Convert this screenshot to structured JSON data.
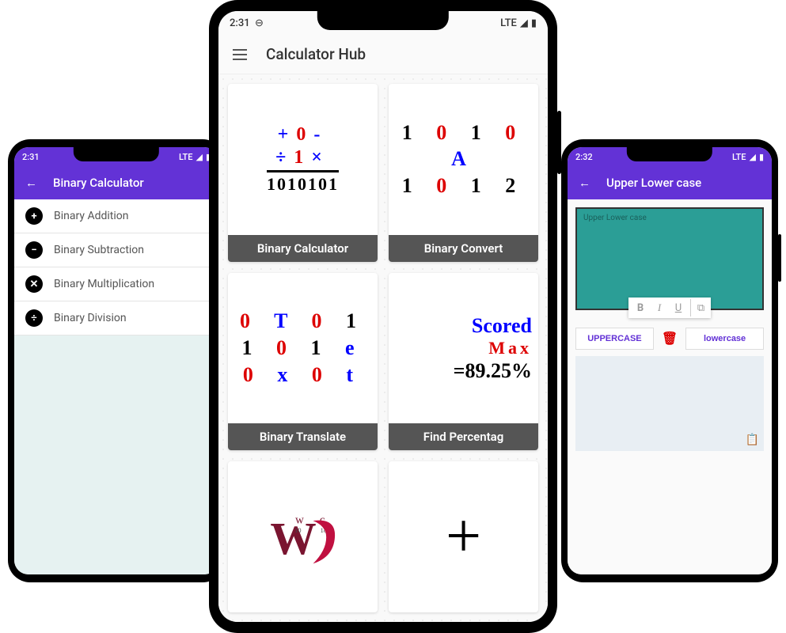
{
  "phones": {
    "left": {
      "status_time": "2:31",
      "status_net": "LTE",
      "title": "Binary Calculator",
      "items": [
        {
          "label": "Binary Addition",
          "sym": "+"
        },
        {
          "label": "Binary Subtraction",
          "sym": "−"
        },
        {
          "label": "Binary Multiplication",
          "sym": "✕"
        },
        {
          "label": "Binary Division",
          "sym": "÷"
        }
      ]
    },
    "center": {
      "status_time": "2:31",
      "status_net": "LTE",
      "title": "Calculator Hub",
      "cards": {
        "binary_calculator": {
          "label": "Binary Calculator",
          "row1_plus": "+",
          "row1_zero": "0",
          "row1_minus": "-",
          "row2_div": "÷",
          "row2_one": "1",
          "row2_mul": "×",
          "row3": "1010101"
        },
        "binary_converter": {
          "label": "Binary Convert",
          "line1": "1 0 1 0",
          "line2_a": "A",
          "line3": "1 0 1 2"
        },
        "binary_translate": {
          "label": "Binary Translate",
          "l1": {
            "a": "0",
            "b": "T",
            "c": "0",
            "d": "1"
          },
          "l2": {
            "a": "1",
            "b": "0",
            "c": "1",
            "d": "e"
          },
          "l3": {
            "a": "0",
            "b": "x",
            "c": "0",
            "d": "t"
          }
        },
        "find_percentage": {
          "label": "Find Percentag",
          "l1": "Scored",
          "l2": "Max",
          "l3": "=89.25%"
        },
        "word_count": {
          "w": "W",
          "small_w": "w",
          "c": "c",
          "n1": "10",
          "n2": "18"
        },
        "plus": {
          "sym": "+"
        }
      }
    },
    "right": {
      "status_time": "2:32",
      "status_net": "LTE",
      "title": "Upper Lower case",
      "placeholder": "Upper Lower case",
      "btn_upper": "UPPERCASE",
      "btn_lower": "lowercase",
      "toolbar": {
        "bold": "B",
        "italic": "I",
        "underline": "U",
        "copy": "⧉"
      }
    }
  }
}
